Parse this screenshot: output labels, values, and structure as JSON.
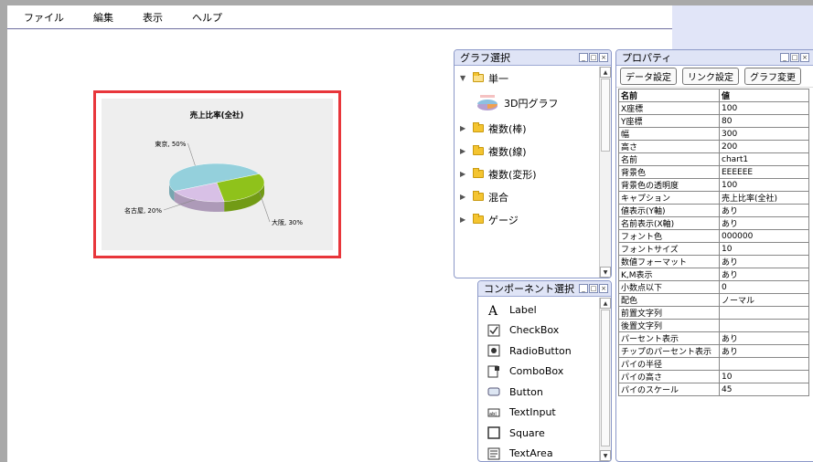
{
  "menu": [
    "ファイル",
    "編集",
    "表示",
    "ヘルプ"
  ],
  "chart_data": {
    "type": "pie",
    "title": "売上比率(全社)",
    "categories": [
      "東京",
      "大阪",
      "名古屋"
    ],
    "values": [
      50,
      30,
      20
    ],
    "labels": [
      "東京, 50%",
      "大阪, 30%",
      "名古屋, 20%"
    ],
    "colors": [
      "#94d0dc",
      "#8fc21b",
      "#d8c0e6"
    ]
  },
  "graph_panel": {
    "title": "グラフ選択",
    "tree": [
      {
        "label": "単一",
        "expanded": true,
        "children": [
          "3D円グラフ"
        ]
      },
      {
        "label": "複数(棒)",
        "expanded": false
      },
      {
        "label": "複数(線)",
        "expanded": false
      },
      {
        "label": "複数(変形)",
        "expanded": false
      },
      {
        "label": "混合",
        "expanded": false
      },
      {
        "label": "ゲージ",
        "expanded": false
      }
    ]
  },
  "component_panel": {
    "title": "コンポーネント選択",
    "items": [
      {
        "label": "Label",
        "icon": "label-icon"
      },
      {
        "label": "CheckBox",
        "icon": "checkbox-icon"
      },
      {
        "label": "RadioButton",
        "icon": "radiobutton-icon"
      },
      {
        "label": "ComboBox",
        "icon": "combobox-icon"
      },
      {
        "label": "Button",
        "icon": "button-icon"
      },
      {
        "label": "TextInput",
        "icon": "textinput-icon"
      },
      {
        "label": "Square",
        "icon": "square-icon"
      },
      {
        "label": "TextArea",
        "icon": "textarea-icon"
      }
    ]
  },
  "properties_panel": {
    "title": "プロパティ",
    "buttons": [
      "データ設定",
      "リンク設定",
      "グラフ変更"
    ],
    "headers": [
      "名前",
      "値"
    ],
    "rows": [
      [
        "X座標",
        "100"
      ],
      [
        "Y座標",
        "80"
      ],
      [
        "幅",
        "300"
      ],
      [
        "高さ",
        "200"
      ],
      [
        "名前",
        "chart1"
      ],
      [
        "背景色",
        "EEEEEE"
      ],
      [
        "背景色の透明度",
        "100"
      ],
      [
        "キャプション",
        "売上比率(全社)"
      ],
      [
        "値表示(Y軸)",
        "あり"
      ],
      [
        "名前表示(X軸)",
        "あり"
      ],
      [
        "フォント色",
        "000000"
      ],
      [
        "フォントサイズ",
        "10"
      ],
      [
        "数値フォーマット",
        "あり"
      ],
      [
        "K,M表示",
        "あり"
      ],
      [
        "小数点以下",
        "0"
      ],
      [
        "配色",
        "ノーマル"
      ],
      [
        "前置文字列",
        ""
      ],
      [
        "後置文字列",
        ""
      ],
      [
        "パーセント表示",
        "あり"
      ],
      [
        "チップのパーセント表示",
        "あり"
      ],
      [
        "パイの半径",
        ""
      ],
      [
        "パイの高さ",
        "10"
      ],
      [
        "パイのスケール",
        "45"
      ]
    ]
  }
}
